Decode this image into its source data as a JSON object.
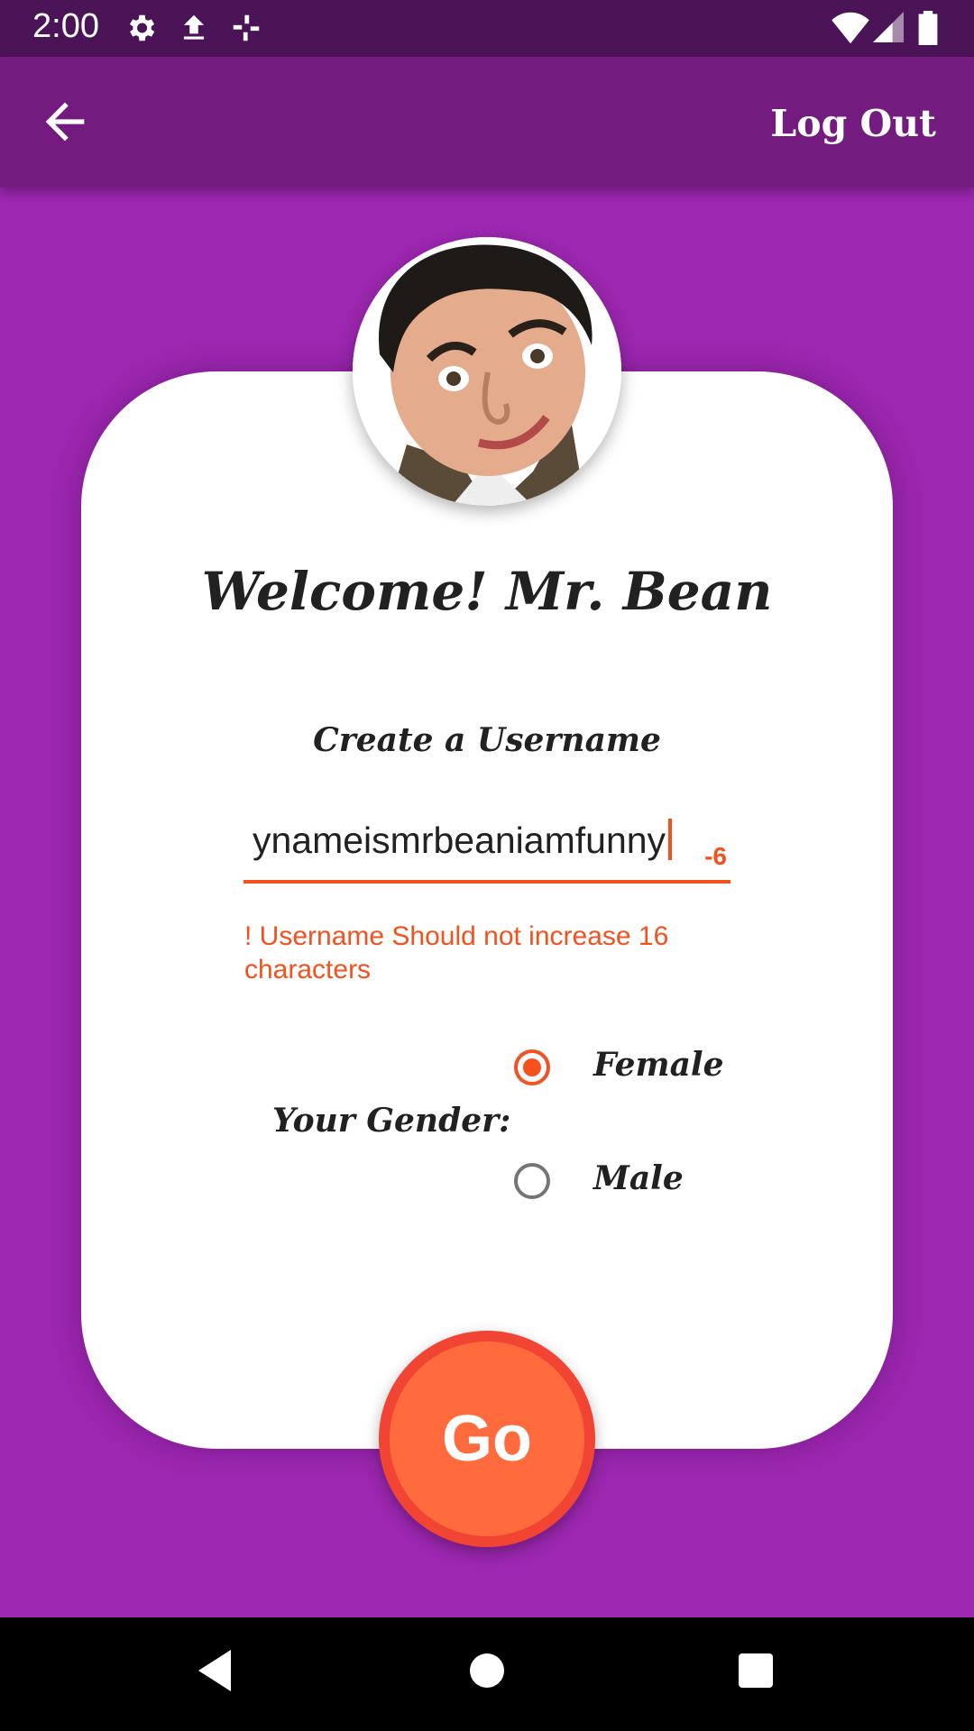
{
  "status_bar": {
    "time": "2:00",
    "icons": [
      "settings-icon",
      "upload-icon",
      "pinwheel-icon",
      "wifi-icon",
      "signal-icon",
      "battery-icon"
    ]
  },
  "app_bar": {
    "back_icon": "arrow-back-icon",
    "logout_label": "Log Out"
  },
  "profile": {
    "avatar": "avatar-photo"
  },
  "form": {
    "welcome": "Welcome! Mr. Bean",
    "username_label": "Create a Username",
    "username_value": "ynameismrbeaniamfunny",
    "char_counter": "-6",
    "error_message": "! Username Should not increase 16 characters",
    "gender_label": "Your Gender:",
    "gender_options": [
      {
        "label": "Female",
        "checked": true
      },
      {
        "label": "Male",
        "checked": false
      }
    ],
    "go_label": "Go"
  },
  "colors": {
    "background": "#9C27B0",
    "app_bar": "#731B7E",
    "status_bar": "#4A1457",
    "accent": "#F4511E",
    "go_button": "#FF6B3D"
  },
  "nav_bar": {
    "icons": [
      "back-triangle-icon",
      "home-circle-icon",
      "recents-square-icon"
    ]
  }
}
